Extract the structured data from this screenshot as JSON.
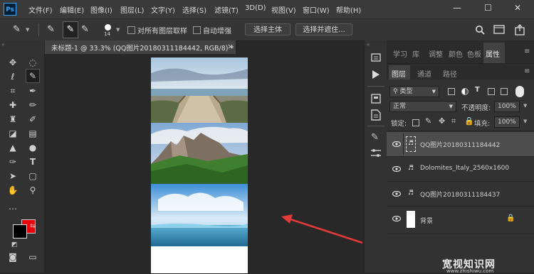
{
  "app": {
    "logo": "Ps"
  },
  "menu": [
    "文件(F)",
    "编辑(E)",
    "图像(I)",
    "图层(L)",
    "文字(Y)",
    "选择(S)",
    "滤镜(T)",
    "3D(D)",
    "视图(V)",
    "窗口(W)",
    "帮助(H)"
  ],
  "window_controls": {
    "minimize": "—",
    "maximize": "☐",
    "close": "✕"
  },
  "options": {
    "brush_size": "14",
    "sample_all_layers": "对所有图层取样",
    "auto_enhance": "自动增强",
    "select_subject": "选择主体",
    "select_and_mask": "选择并遮住..."
  },
  "document": {
    "tab_title": "未标题-1 @ 33.3% (QQ图片20180311184442, RGB/8) *",
    "close_glyph": "×"
  },
  "right_top_tabs": [
    "学习",
    "库",
    "调整",
    "颜色",
    "色板",
    "属性"
  ],
  "layer_tabs": [
    "图层",
    "通道",
    "路径"
  ],
  "layer_controls": {
    "filter_kind": "类型",
    "blend_mode": "正常",
    "opacity_label": "不透明度:",
    "opacity_value": "100%",
    "lock_label": "锁定:",
    "fill_label": "填充:",
    "fill_value": "100%"
  },
  "layers": [
    {
      "name": "QQ图片20180311184442",
      "selected": true
    },
    {
      "name": "Dolomites_Italy_2560x1600",
      "selected": false
    },
    {
      "name": "QQ图片20180311184437",
      "selected": false
    },
    {
      "name": "背景",
      "selected": false,
      "locked": true
    }
  ],
  "watermark": "www.zhishiwu.com",
  "watermark_logo": "宽视知识网",
  "colors": {
    "foreground": "#000000",
    "background": "#e8000b",
    "accent": "#31a8ff",
    "arrow": "#e23a3a"
  }
}
